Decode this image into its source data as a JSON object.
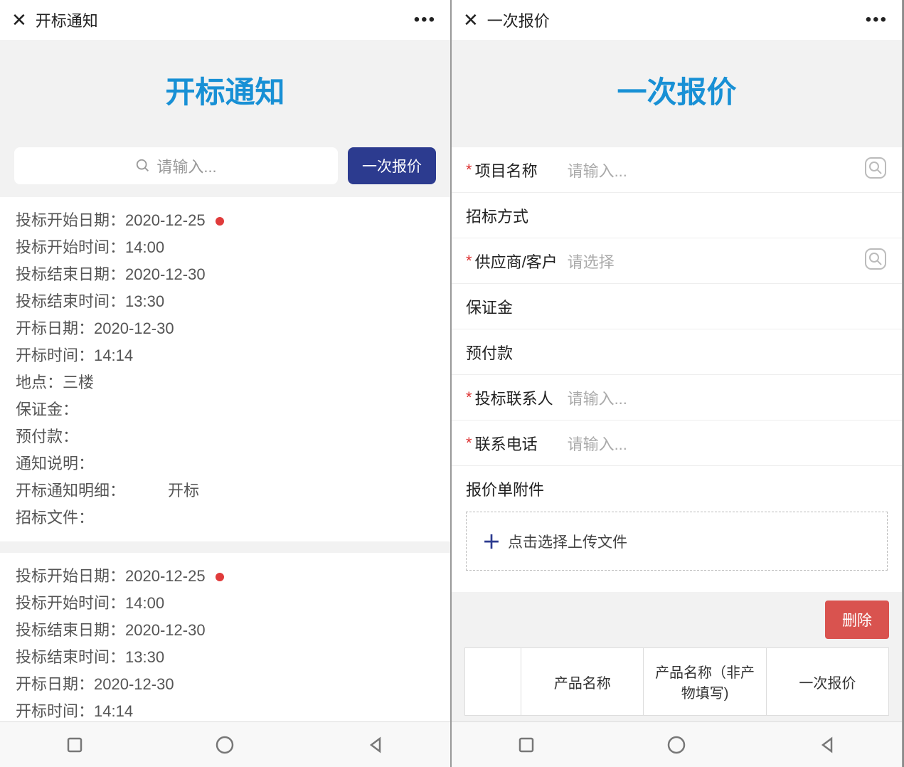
{
  "left": {
    "navTitle": "开标通知",
    "pageTitle": "开标通知",
    "searchPlaceholder": "请输入...",
    "quoteBtn": "一次报价",
    "cards": [
      {
        "rows": [
          {
            "label": "投标开始日期：",
            "value": "2020-12-25",
            "dot": true
          },
          {
            "label": "投标开始时间：",
            "value": "14:00"
          },
          {
            "label": "投标结束日期：",
            "value": "2020-12-30"
          },
          {
            "label": "投标结束时间：",
            "value": "13:30"
          },
          {
            "label": "开标日期：",
            "value": "2020-12-30"
          },
          {
            "label": "开标时间：",
            "value": "14:14"
          },
          {
            "label": "地点：",
            "value": "三楼"
          },
          {
            "label": "保证金：",
            "value": ""
          },
          {
            "label": "预付款：",
            "value": ""
          },
          {
            "label": "通知说明：",
            "value": ""
          },
          {
            "label": "开标通知明细：",
            "value": "开标",
            "indent": true
          },
          {
            "label": "招标文件：",
            "value": ""
          }
        ]
      },
      {
        "rows": [
          {
            "label": "投标开始日期：",
            "value": "2020-12-25",
            "dot": true
          },
          {
            "label": "投标开始时间：",
            "value": "14:00"
          },
          {
            "label": "投标结束日期：",
            "value": "2020-12-30"
          },
          {
            "label": "投标结束时间：",
            "value": "13:30"
          },
          {
            "label": "开标日期：",
            "value": "2020-12-30"
          },
          {
            "label": "开标时间：",
            "value": "14:14"
          }
        ]
      }
    ]
  },
  "right": {
    "navTitle": "一次报价",
    "pageTitle": "一次报价",
    "form": [
      {
        "req": true,
        "label": "项目名称",
        "placeholder": "请输入...",
        "lookup": true
      },
      {
        "req": false,
        "label": "招标方式",
        "placeholder": ""
      },
      {
        "req": true,
        "label": "供应商/客户",
        "placeholder": "请选择",
        "lookup": true
      },
      {
        "req": false,
        "label": "保证金",
        "placeholder": ""
      },
      {
        "req": false,
        "label": "预付款",
        "placeholder": ""
      },
      {
        "req": true,
        "label": "投标联系人",
        "placeholder": "请输入..."
      },
      {
        "req": true,
        "label": "联系电话",
        "placeholder": "请输入..."
      }
    ],
    "attachTitle": "报价单附件",
    "uploadText": "点击选择上传文件",
    "deleteBtn": "删除",
    "tableHeaders": [
      "",
      "产品名称",
      "产品名称（非产物填写)",
      "一次报价"
    ]
  }
}
